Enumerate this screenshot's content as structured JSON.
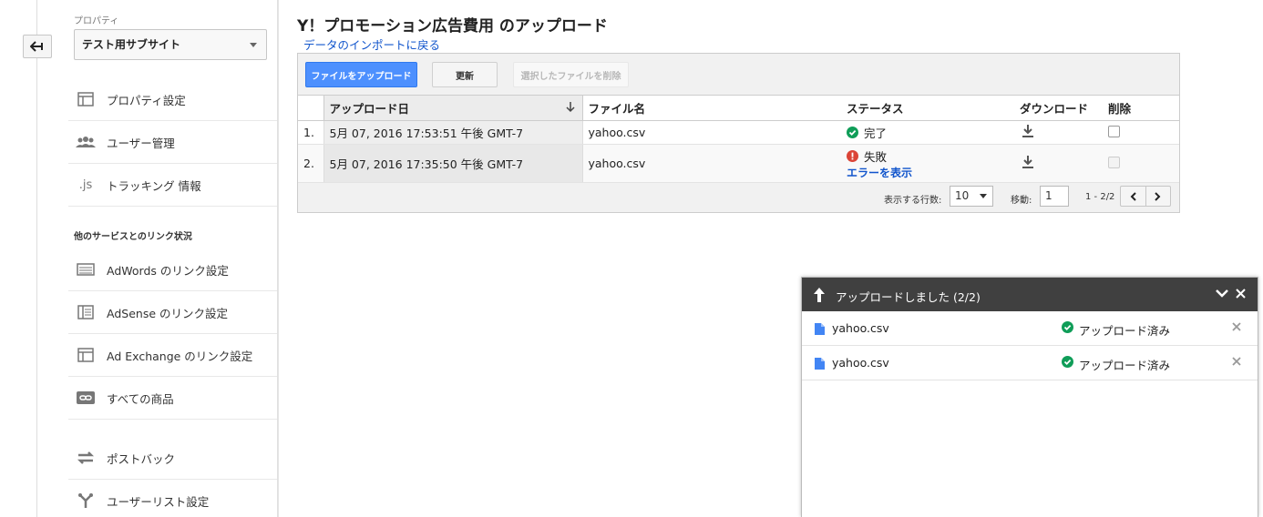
{
  "sidebar": {
    "property_label": "プロパティ",
    "property_value": "テスト用サブサイト",
    "items": [
      {
        "label": "プロパティ設定",
        "icon": "window-icon"
      },
      {
        "label": "ユーザー管理",
        "icon": "users-icon"
      },
      {
        "label": "トラッキング 情報",
        "icon": "js-icon",
        "icon_text": ".js"
      }
    ],
    "section_heading": "他のサービスとのリンク状況",
    "link_items": [
      {
        "label": "AdWords のリンク設定",
        "icon": "adwords-icon"
      },
      {
        "label": "AdSense のリンク設定",
        "icon": "adsense-icon"
      },
      {
        "label": "Ad Exchange のリンク設定",
        "icon": "adexchange-icon"
      },
      {
        "label": "すべての商品",
        "icon": "link-icon"
      }
    ],
    "other_items": [
      {
        "label": "ポストバック",
        "icon": "postback-icon"
      },
      {
        "label": "ユーザーリスト設定",
        "icon": "user-list-icon"
      }
    ]
  },
  "main": {
    "title": "Y！プロモーション広告費用 のアップロード",
    "back_link": "データのインポートに戻る",
    "toolbar": {
      "upload_label": "ファイルをアップロード",
      "refresh_label": "更新",
      "delete_label": "選択したファイルを削除"
    },
    "table": {
      "headers": {
        "date": "アップロード日",
        "file": "ファイル名",
        "status": "ステータス",
        "download": "ダウンロード",
        "delete": "削除"
      },
      "rows": [
        {
          "num": "1.",
          "date": "5月 07, 2016 17:53:51 午後 GMT-7",
          "file": "yahoo.csv",
          "status": "完了",
          "status_type": "success"
        },
        {
          "num": "2.",
          "date": "5月 07, 2016 17:35:50 午後 GMT-7",
          "file": "yahoo.csv",
          "status": "失敗",
          "status_type": "error",
          "error_link": "エラーを表示"
        }
      ]
    },
    "pager": {
      "rows_label": "表示する行数:",
      "rows_value": "10",
      "goto_label": "移動:",
      "goto_value": "1",
      "range": "1 - 2/2"
    }
  },
  "upload_dialog": {
    "title": "アップロードしました (2/2)",
    "items": [
      {
        "file": "yahoo.csv",
        "status": "アップロード済み"
      },
      {
        "file": "yahoo.csv",
        "status": "アップロード済み"
      }
    ]
  },
  "colors": {
    "primary": "#4d90fe",
    "link": "#1155cc",
    "success": "#0f9d58",
    "error": "#db4437",
    "dialog_header": "#404040"
  }
}
